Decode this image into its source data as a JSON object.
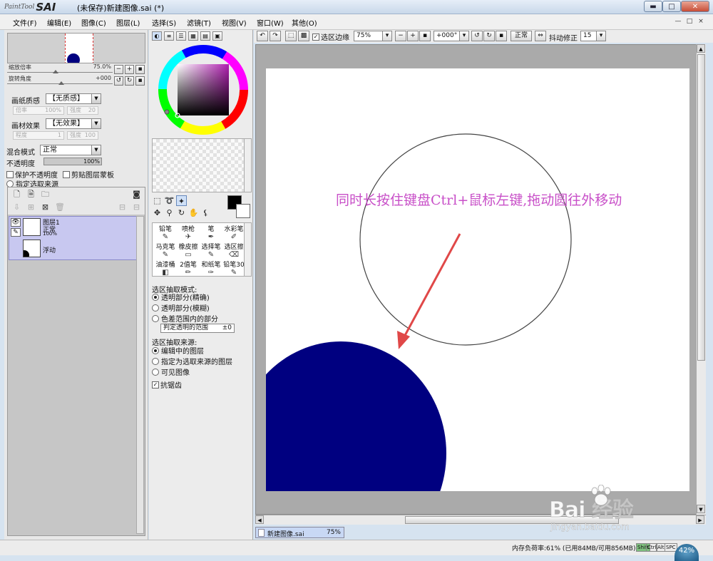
{
  "window": {
    "logo_small": "PaintTool",
    "logo_big": "SAI",
    "title": "(未保存)新建图像.sai (*)",
    "min_glyph": "▬",
    "max_glyph": "□",
    "close_glyph": "✕"
  },
  "menu": {
    "items": [
      "文件(F)",
      "编辑(E)",
      "图像(C)",
      "图层(L)",
      "选择(S)",
      "滤镜(T)",
      "视图(V)",
      "窗口(W)",
      "其他(O)"
    ],
    "mdi_min": "—",
    "mdi_max": "□",
    "mdi_close": "×"
  },
  "navigator": {
    "zoom_label": "缩放倍率",
    "zoom_value": "75.0%",
    "rotate_label": "旋转角度",
    "rotate_value": "+000"
  },
  "paper": {
    "texture_label": "画纸质感",
    "texture_value": "【无质感】",
    "scale_label": "倍率",
    "scale_value": "100%",
    "strength_label": "强度",
    "strength_value": "20",
    "effect_label": "画材效果",
    "effect_value": "【无效果】",
    "width_label": "程度",
    "width_value": "1",
    "effect_strength_label": "强度",
    "effect_strength_value": "100"
  },
  "layer_props": {
    "blend_label": "混合模式",
    "blend_value": "正常",
    "opacity_label": "不透明度",
    "opacity_value": "100%",
    "preserve_opacity": "保护不透明度",
    "clip_group": "剪贴图层蒙板",
    "selection_source": "指定选取来源"
  },
  "layers": {
    "name": "图层1",
    "mode": "正常",
    "opacity": "100%",
    "floating": "浮动"
  },
  "color": {
    "tabs": [
      "◐",
      "≡",
      "☰",
      "▦",
      "▤",
      "▣"
    ]
  },
  "brushes": [
    {
      "name": "铅笔",
      "icon": "✎"
    },
    {
      "name": "喷枪",
      "icon": "✈"
    },
    {
      "name": "笔",
      "icon": "✒"
    },
    {
      "name": "水彩笔",
      "icon": "✐"
    },
    {
      "name": "马克笔",
      "icon": "✎"
    },
    {
      "name": "橡皮擦",
      "icon": "▭"
    },
    {
      "name": "选择笔",
      "icon": "✎"
    },
    {
      "name": "选区擦",
      "icon": "⌫"
    },
    {
      "name": "油漆桶",
      "icon": "◧"
    },
    {
      "name": "2值笔",
      "icon": "✏"
    },
    {
      "name": "和纸笔",
      "icon": "✑"
    },
    {
      "name": "铅笔30",
      "icon": "✎"
    }
  ],
  "selection": {
    "mode_title": "选区抽取模式:",
    "mode_1": "透明部分(精确)",
    "mode_2": "透明部分(模糊)",
    "mode_3": "色差范围内的部分",
    "judge_label": "判定透明的范围",
    "judge_value": "±0",
    "source_title": "选区抽取来源:",
    "source_1": "编辑中的图层",
    "source_2": "指定为选取来源的图层",
    "source_3": "可见图像",
    "antialias": "抗锯齿"
  },
  "toolbar": {
    "selection_edge": "选区边缘",
    "zoom": "75%",
    "angle": "+000°",
    "mode": "正常",
    "stabilizer_label": "抖动修正",
    "stabilizer_value": "15"
  },
  "canvas": {
    "annotation": "同时长按住键盘Ctrl+鼠标左键,拖动圆往外移动",
    "fill_color": "#000080",
    "annotation_color": "#c84fc8",
    "arrow_color": "#e04848"
  },
  "doc_tab": {
    "name": "新建图像.sai",
    "zoom": "75%"
  },
  "status": {
    "memory": "内存负荷率:61% (已用84MB/可用856MB)",
    "keys": [
      "Shift",
      "Ctrl",
      "Alt",
      "SPC"
    ],
    "zoom_badge": "42%"
  },
  "watermark": {
    "main": "Bai   经验",
    "sub": "jingyan.baidu.com"
  }
}
